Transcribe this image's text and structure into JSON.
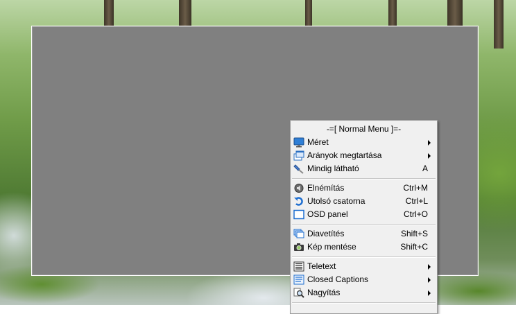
{
  "menu": {
    "title": "-=[ Normal Menu ]=-",
    "items": [
      {
        "label": "Méret",
        "shortcut": "",
        "submenu": true,
        "icon": "monitor-icon"
      },
      {
        "label": "Arányok megtartása",
        "shortcut": "",
        "submenu": true,
        "icon": "windows-icon"
      },
      {
        "label": "Mindig látható",
        "shortcut": "A",
        "submenu": false,
        "icon": "pin-icon"
      },
      {
        "label": "Elnémítás",
        "shortcut": "Ctrl+M",
        "submenu": false,
        "icon": "speaker-mute-icon"
      },
      {
        "label": "Utolsó csatorna",
        "shortcut": "Ctrl+L",
        "submenu": false,
        "icon": "undo-arrow-icon"
      },
      {
        "label": "OSD panel",
        "shortcut": "Ctrl+O",
        "submenu": false,
        "icon": "window-icon"
      },
      {
        "label": "Diavetítés",
        "shortcut": "Shift+S",
        "submenu": false,
        "icon": "slides-icon"
      },
      {
        "label": "Kép mentése",
        "shortcut": "Shift+C",
        "submenu": false,
        "icon": "camera-icon"
      },
      {
        "label": "Teletext",
        "shortcut": "",
        "submenu": true,
        "icon": "teletext-icon"
      },
      {
        "label": "Closed Captions",
        "shortcut": "",
        "submenu": true,
        "icon": "captions-icon"
      },
      {
        "label": "Nagyítás",
        "shortcut": "",
        "submenu": true,
        "icon": "magnifier-icon"
      }
    ]
  }
}
